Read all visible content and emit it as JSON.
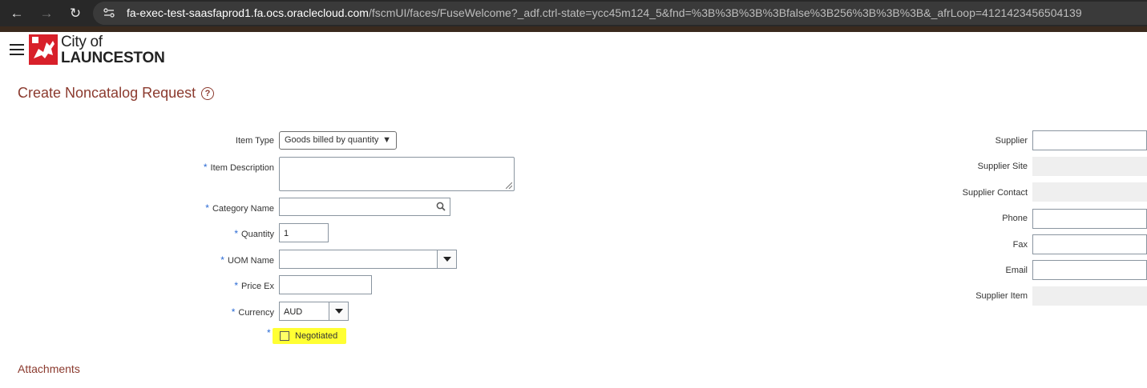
{
  "browser": {
    "url_host": "fa-exec-test-saasfaprod1.fa.ocs.oraclecloud.com",
    "url_path": "/fscmUI/faces/FuseWelcome?_adf.ctrl-state=ycc45m124_5&fnd=%3B%3B%3B%3Bfalse%3B256%3B%3B%3B&_afrLoop=4121423456504139"
  },
  "header": {
    "logo_line1": "City of",
    "logo_line2": "LAUNCESTON"
  },
  "page": {
    "title": "Create Noncatalog Request",
    "help": "?"
  },
  "form": {
    "item_type_label": "Item Type",
    "item_type_value": "Goods billed by quantity",
    "item_description_label": "Item Description",
    "category_name_label": "Category Name",
    "quantity_label": "Quantity",
    "quantity_value": "1",
    "uom_name_label": "UOM Name",
    "price_ex_label": "Price Ex",
    "currency_label": "Currency",
    "currency_value": "AUD",
    "negotiated_label": "Negotiated",
    "required_mark": "*"
  },
  "supplier": {
    "supplier_label": "Supplier",
    "supplier_site_label": "Supplier Site",
    "supplier_contact_label": "Supplier Contact",
    "phone_label": "Phone",
    "fax_label": "Fax",
    "email_label": "Email",
    "supplier_item_label": "Supplier Item"
  },
  "sections": {
    "attachments": "Attachments"
  },
  "colors": {
    "accent": "#8b3a2e",
    "required": "#2a6ad4",
    "highlight": "#ffff33"
  }
}
